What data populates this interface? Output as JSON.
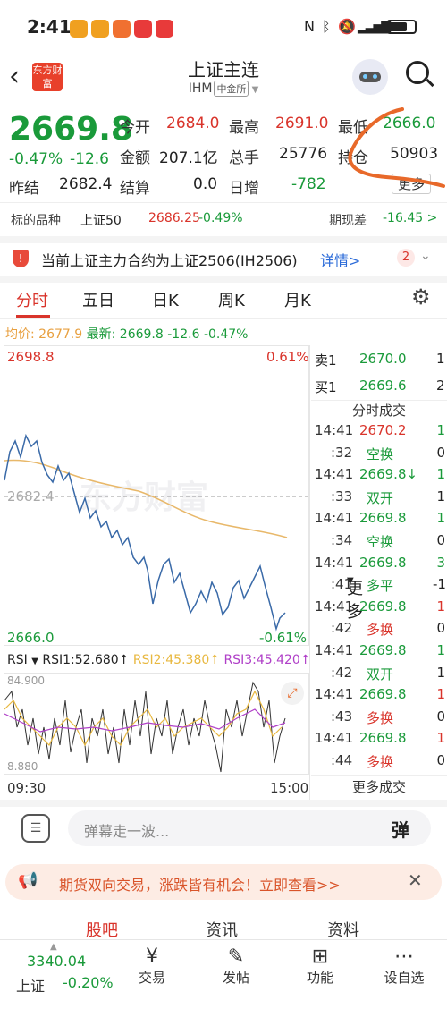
{
  "status_bar": {
    "time": "2:41",
    "battery": ""
  },
  "header": {
    "title": "上证主连",
    "code": "IHM",
    "exchange": "中金所",
    "logo_text": "东方财富"
  },
  "quote": {
    "price": "2669.8",
    "change_pct": "-0.47%",
    "change": "-12.6",
    "prev_close_label": "昨结",
    "prev_close": "2682.4",
    "open_label": "今开",
    "open": "2684.0",
    "amount_label": "金额",
    "amount": "207.1亿",
    "settle_label": "结算",
    "settle": "0.0",
    "high_label": "最高",
    "high": "2691.0",
    "volume_label": "总手",
    "volume": "25776",
    "daily_inc_label": "日增",
    "daily_inc": "-782",
    "low_label": "最低",
    "low": "2666.0",
    "oi_label": "持仓",
    "oi": "50903",
    "more_label": "更多"
  },
  "underlying": {
    "label": "标的品种",
    "name": "上证50",
    "price": "2686.25",
    "pct": "-0.49%",
    "basis_label": "期现差",
    "basis": "-16.45 >"
  },
  "notice": {
    "text": "当前上证主力合约为上证2506(IH2506)",
    "link": "详情>",
    "badge": "2"
  },
  "tabs": [
    "分时",
    "五日",
    "日K",
    "周K",
    "月K",
    "更多"
  ],
  "avg_line": {
    "avg_label": "均价:",
    "avg": "2677.9",
    "latest_label": "最新:",
    "latest": "2669.8",
    "chg": "-12.6",
    "pct": "-0.47%"
  },
  "chart": {
    "top_price": "2698.8",
    "top_pct": "0.61%",
    "mid_price": "2682.4",
    "bottom_price": "2666.0",
    "bottom_pct": "-0.61%",
    "time_start": "09:30",
    "time_end": "15:00",
    "watermark": "东方财富"
  },
  "rsi": {
    "name": "RSI",
    "rsi1": "RSI1:52.680↑",
    "rsi2": "RSI2:45.380↑",
    "rsi3": "RSI3:45.420↑",
    "top": "84.900",
    "bottom": "8.880"
  },
  "order_book": {
    "sell_label": "卖1",
    "sell_price": "2670.0",
    "sell_qty": "1",
    "buy_label": "买1",
    "buy_price": "2669.6",
    "buy_qty": "2",
    "trades_title": "分时成交",
    "more_trades": "更多成交",
    "trades": [
      {
        "time": "14:41",
        "price": "2670.2",
        "qty": "1",
        "pc": "red",
        "qc": "green"
      },
      {
        "time": ":32",
        "price": "空换",
        "qty": "0",
        "pc": "green",
        "qc": "dark"
      },
      {
        "time": "14:41",
        "price": "2669.8↓",
        "qty": "1",
        "pc": "green",
        "qc": "green"
      },
      {
        "time": ":33",
        "price": "双开",
        "qty": "1",
        "pc": "green",
        "qc": "dark"
      },
      {
        "time": "14:41",
        "price": "2669.8",
        "qty": "1",
        "pc": "green",
        "qc": "green"
      },
      {
        "time": ":34",
        "price": "空换",
        "qty": "0",
        "pc": "green",
        "qc": "dark"
      },
      {
        "time": "14:41",
        "price": "2669.8",
        "qty": "3",
        "pc": "green",
        "qc": "green"
      },
      {
        "time": ":41",
        "price": "多平",
        "qty": "-1",
        "pc": "green",
        "qc": "dark"
      },
      {
        "time": "14:41",
        "price": "2669.8",
        "qty": "1",
        "pc": "green",
        "qc": "red"
      },
      {
        "time": ":42",
        "price": "多换",
        "qty": "0",
        "pc": "red",
        "qc": "dark"
      },
      {
        "time": "14:41",
        "price": "2669.8",
        "qty": "1",
        "pc": "green",
        "qc": "green"
      },
      {
        "time": ":42",
        "price": "双开",
        "qty": "1",
        "pc": "green",
        "qc": "dark"
      },
      {
        "time": "14:41",
        "price": "2669.8",
        "qty": "1",
        "pc": "green",
        "qc": "red"
      },
      {
        "time": ":43",
        "price": "多换",
        "qty": "0",
        "pc": "red",
        "qc": "dark"
      },
      {
        "time": "14:41",
        "price": "2669.8",
        "qty": "1",
        "pc": "green",
        "qc": "red"
      },
      {
        "time": ":44",
        "price": "多换",
        "qty": "0",
        "pc": "red",
        "qc": "dark"
      }
    ]
  },
  "danmu": {
    "placeholder": "弹幕走一波...",
    "btn": "弹"
  },
  "promo": {
    "text": "期货双向交易，涨跌皆有机会！立即查看>>"
  },
  "sub_tabs": [
    "股吧",
    "资讯",
    "资料"
  ],
  "bottom_nav": {
    "index_value": "3340.04",
    "index_name": "上证",
    "index_pct": "-0.20%",
    "items": [
      "交易",
      "发帖",
      "功能",
      "设自选"
    ]
  },
  "colors": {
    "up": "#d9342b",
    "down": "#1a9a3a",
    "line": "#3a6aa8",
    "avg": "#e8b86a",
    "accent": "#e8692a"
  }
}
